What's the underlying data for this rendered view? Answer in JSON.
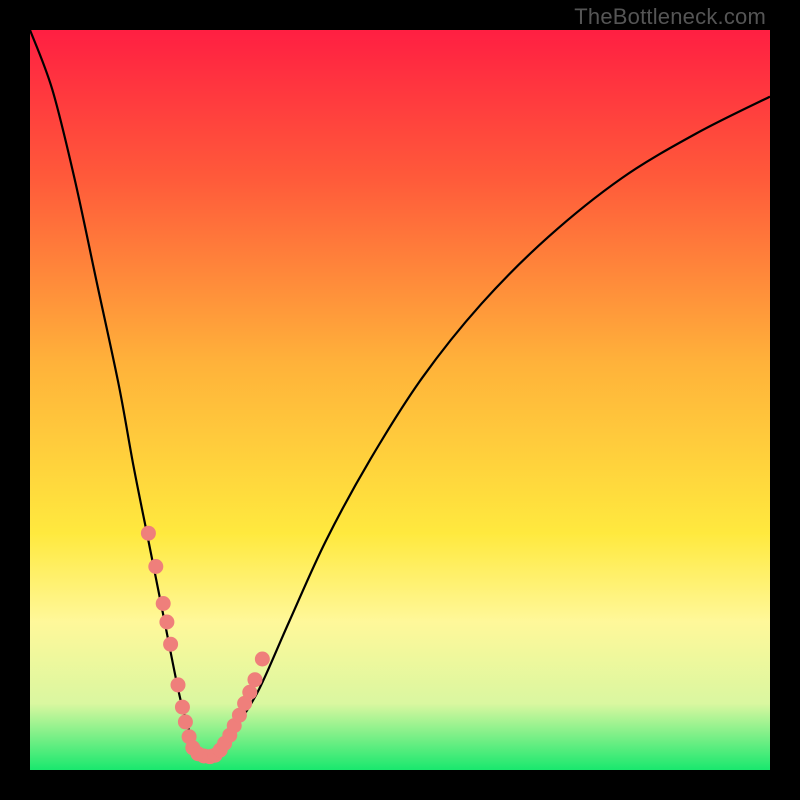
{
  "watermark": "TheBottleneck.com",
  "chart_data": {
    "type": "line",
    "title": "",
    "xlabel": "",
    "ylabel": "",
    "xlim": [
      0,
      100
    ],
    "ylim": [
      0,
      100
    ],
    "gradient_stops": [
      {
        "offset": 0,
        "color": "#ff1f42"
      },
      {
        "offset": 20,
        "color": "#ff5a3a"
      },
      {
        "offset": 45,
        "color": "#ffb23a"
      },
      {
        "offset": 68,
        "color": "#ffe93e"
      },
      {
        "offset": 80,
        "color": "#fff89a"
      },
      {
        "offset": 91,
        "color": "#daf7a0"
      },
      {
        "offset": 100,
        "color": "#19e86e"
      }
    ],
    "series": [
      {
        "name": "bottleneck-curve",
        "x": [
          0,
          3,
          6,
          9,
          12,
          14,
          16,
          18,
          20,
          21,
          22,
          23,
          24,
          25,
          26,
          28,
          31,
          35,
          40,
          46,
          53,
          61,
          70,
          80,
          90,
          100
        ],
        "values": [
          0,
          8,
          20,
          34,
          48,
          59,
          69,
          79,
          89,
          93,
          96,
          98,
          98,
          98,
          97,
          94,
          89,
          80,
          69,
          58,
          47,
          37,
          28,
          20,
          14,
          9
        ]
      }
    ],
    "markers": {
      "name": "highlight-points",
      "color": "#ef7f7b",
      "x": [
        16,
        17,
        18,
        18.5,
        19,
        20,
        20.6,
        21,
        21.5,
        22,
        22.7,
        23.5,
        24.3,
        25,
        25.7,
        26.3,
        27,
        27.6,
        28.3,
        29,
        29.7,
        30.4,
        31.4
      ],
      "values": [
        68,
        72.5,
        77.5,
        80,
        83,
        88.5,
        91.5,
        93.5,
        95.5,
        97,
        97.8,
        98.1,
        98.2,
        98,
        97.3,
        96.4,
        95.3,
        94,
        92.6,
        91,
        89.5,
        87.8,
        85
      ]
    }
  }
}
